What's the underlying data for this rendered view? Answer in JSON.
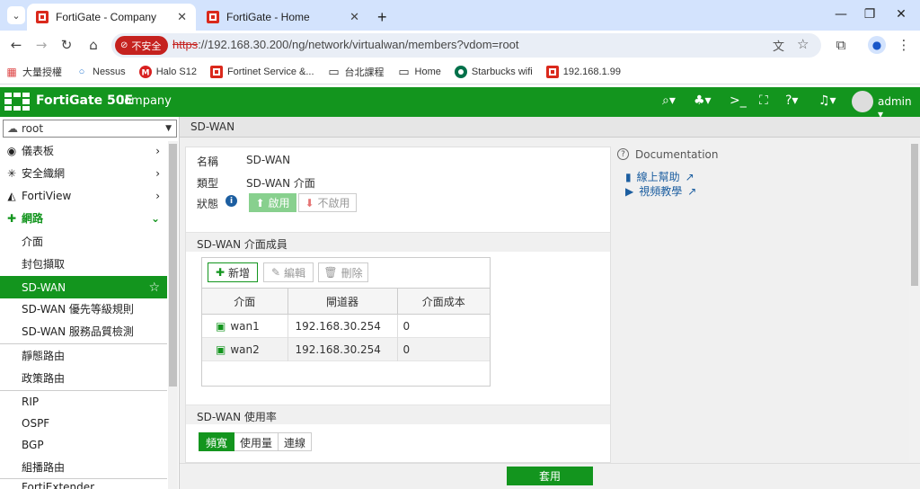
{
  "browser": {
    "tabs": [
      {
        "title": "FortiGate - Company",
        "active": true
      },
      {
        "title": "FortiGate - Home",
        "active": false
      }
    ],
    "new_tab": "+",
    "insecure_label": "不安全",
    "url_proto": "https",
    "url_rest": "://192.168.30.200/ng/network/virtualwan/members?vdom=root",
    "bookmarks": [
      "大量授權",
      "Nessus",
      "Halo S12",
      "Fortinet Service &...",
      "台北課程",
      "Home",
      "Starbucks wifi",
      "192.168.1.99"
    ]
  },
  "header": {
    "brand": "FortiGate 50E",
    "company": "Company",
    "user": "admin"
  },
  "sidebar": {
    "vdom": "root",
    "items": [
      {
        "label": "儀表板",
        "icon": "dashboard-icon",
        "chevron": "›"
      },
      {
        "label": "安全織網",
        "icon": "fabric-icon",
        "chevron": "›"
      },
      {
        "label": "FortiView",
        "icon": "chart-icon",
        "chevron": "›"
      },
      {
        "label": "網路",
        "icon": "network-icon",
        "chevron": "⌄"
      },
      {
        "label": "介面"
      },
      {
        "label": "封包擷取"
      },
      {
        "label": "SD-WAN"
      },
      {
        "label": "SD-WAN 優先等級規則"
      },
      {
        "label": "SD-WAN 服務品質檢測"
      },
      {
        "label": "靜態路由"
      },
      {
        "label": "政策路由"
      },
      {
        "label": "RIP"
      },
      {
        "label": "OSPF"
      },
      {
        "label": "BGP"
      },
      {
        "label": "組播路由"
      },
      {
        "label": "FortiExtender"
      }
    ]
  },
  "page": {
    "title": "SD-WAN",
    "name_label": "名稱",
    "name_value": "SD-WAN",
    "type_label": "類型",
    "type_value": "SD-WAN 介面",
    "status_label": "狀態",
    "enable_label": "啟用",
    "disable_label": "不啟用",
    "members_section": "SD-WAN 介面成員",
    "add_label": "新增",
    "edit_label": "編輯",
    "delete_label": "刪除",
    "table": {
      "headers": [
        "介面",
        "閘道器",
        "介面成本"
      ],
      "rows": [
        {
          "iface": "wan1",
          "gateway": "192.168.30.254",
          "cost": "0"
        },
        {
          "iface": "wan2",
          "gateway": "192.168.30.254",
          "cost": "0"
        }
      ]
    },
    "usage_section": "SD-WAN 使用率",
    "usage_tabs": [
      "頻寬",
      "使用量",
      "連線"
    ],
    "apply_label": "套用"
  },
  "docs": {
    "title": "Documentation",
    "links": [
      "線上幫助",
      "視頻教學"
    ]
  },
  "colors": {
    "fortigate_green": "#13951e",
    "insecure_red": "#c5221f",
    "link_blue": "#1c5ea0"
  }
}
